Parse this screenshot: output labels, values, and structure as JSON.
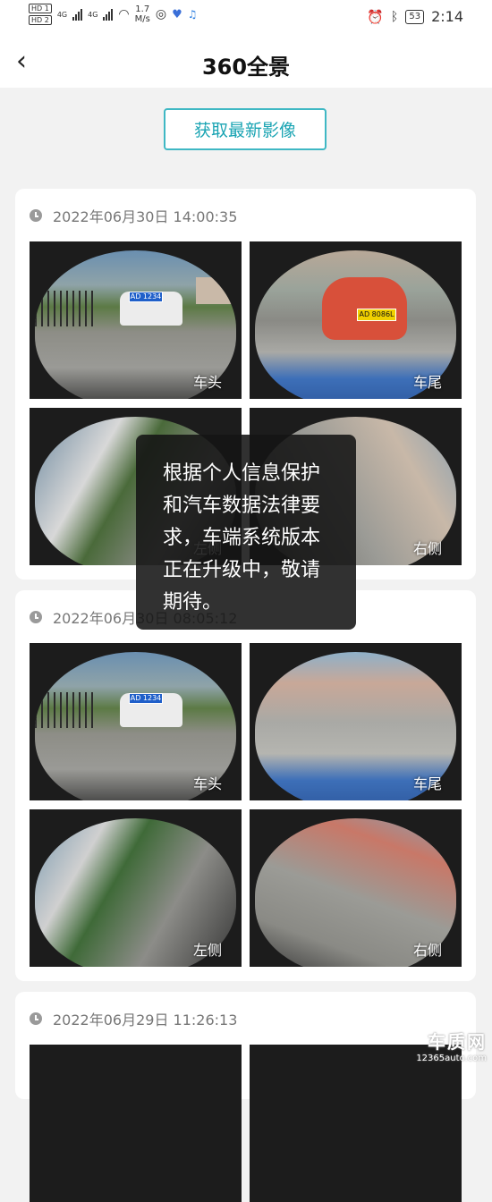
{
  "status_bar": {
    "hd1": "HD 1",
    "hd2": "HD 2",
    "net1": "4G",
    "net2": "4G",
    "speed_value": "1.7",
    "speed_unit": "M/s",
    "battery": "53",
    "time": "2:14",
    "icons": [
      "wechat-icon",
      "app-icon",
      "music-icon",
      "alarm-icon",
      "bluetooth-icon"
    ]
  },
  "header": {
    "back": "‹",
    "title": "360全景"
  },
  "latest_button": "获取最新影像",
  "cards": [
    {
      "time": "2022年06月30日 14:00:35",
      "photos": [
        {
          "label": "车头",
          "plate": "AD 1234"
        },
        {
          "label": "车尾",
          "plate": "AD 8086L"
        },
        {
          "label": "左侧"
        },
        {
          "label": "右侧"
        }
      ]
    },
    {
      "time": "2022年06月30日 08:05:12",
      "photos": [
        {
          "label": "车头",
          "plate": "AD 1234"
        },
        {
          "label": "车尾"
        },
        {
          "label": "左侧"
        },
        {
          "label": "右侧"
        }
      ]
    },
    {
      "time": "2022年06月29日 11:26:13",
      "photos": []
    }
  ],
  "toast": {
    "message": "根据个人信息保护和汽车数据法律要求，车端系统版本正在升级中，敬请期待。"
  },
  "watermark": {
    "brand": "车质网",
    "url": "12365auto.com"
  },
  "colors": {
    "accent": "#1aa4b3",
    "background": "#f2f2f2"
  }
}
